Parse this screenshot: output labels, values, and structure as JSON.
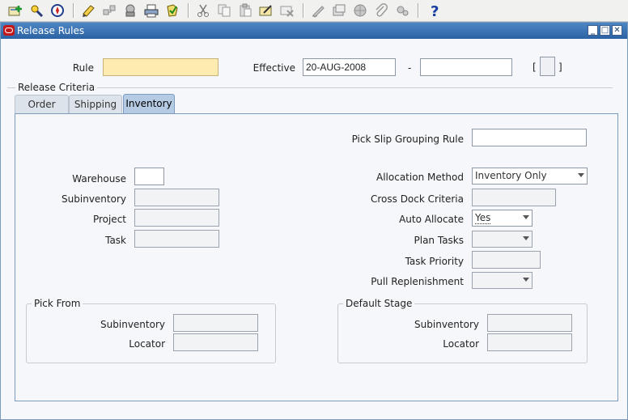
{
  "toolbar": {
    "icons": [
      "new-icon",
      "find-icon",
      "navigator-icon",
      "save-icon",
      "next-step-icon",
      "switch-responsibility-icon",
      "print-icon",
      "close-form-icon",
      "cut-icon",
      "copy-icon",
      "paste-icon",
      "clear-record-icon",
      "delete-icon",
      "edit-field-icon",
      "zoom-icon",
      "translations-icon",
      "attachments-icon",
      "folder-tools-icon",
      "help-icon"
    ]
  },
  "window": {
    "title": "Release Rules"
  },
  "header": {
    "rule_label": "Rule",
    "rule_value": "",
    "effective_label": "Effective",
    "effective_from": "20-AUG-2008",
    "date_separator": "-",
    "effective_to": "",
    "bracket_open": "[",
    "bracket_close": "]"
  },
  "release_criteria": {
    "label": "Release Criteria",
    "tabs": [
      "Order",
      "Shipping",
      "Inventory"
    ],
    "active_tab": "Inventory"
  },
  "inventory": {
    "pick_slip_grouping_rule_label": "Pick Slip Grouping Rule",
    "pick_slip_grouping_rule_value": "",
    "warehouse_label": "Warehouse",
    "warehouse_value": "",
    "subinventory_label": "Subinventory",
    "project_label": "Project",
    "task_label": "Task",
    "allocation_method_label": "Allocation Method",
    "allocation_method_value": "Inventory Only",
    "cross_dock_criteria_label": "Cross Dock Criteria",
    "auto_allocate_label": "Auto Allocate",
    "auto_allocate_value": "Yes",
    "plan_tasks_label": "Plan Tasks",
    "task_priority_label": "Task Priority",
    "pull_replenishment_label": "Pull Replenishment"
  },
  "pick_from": {
    "label": "Pick From",
    "subinventory_label": "Subinventory",
    "locator_label": "Locator"
  },
  "default_stage": {
    "label": "Default Stage",
    "subinventory_label": "Subinventory",
    "locator_label": "Locator"
  }
}
